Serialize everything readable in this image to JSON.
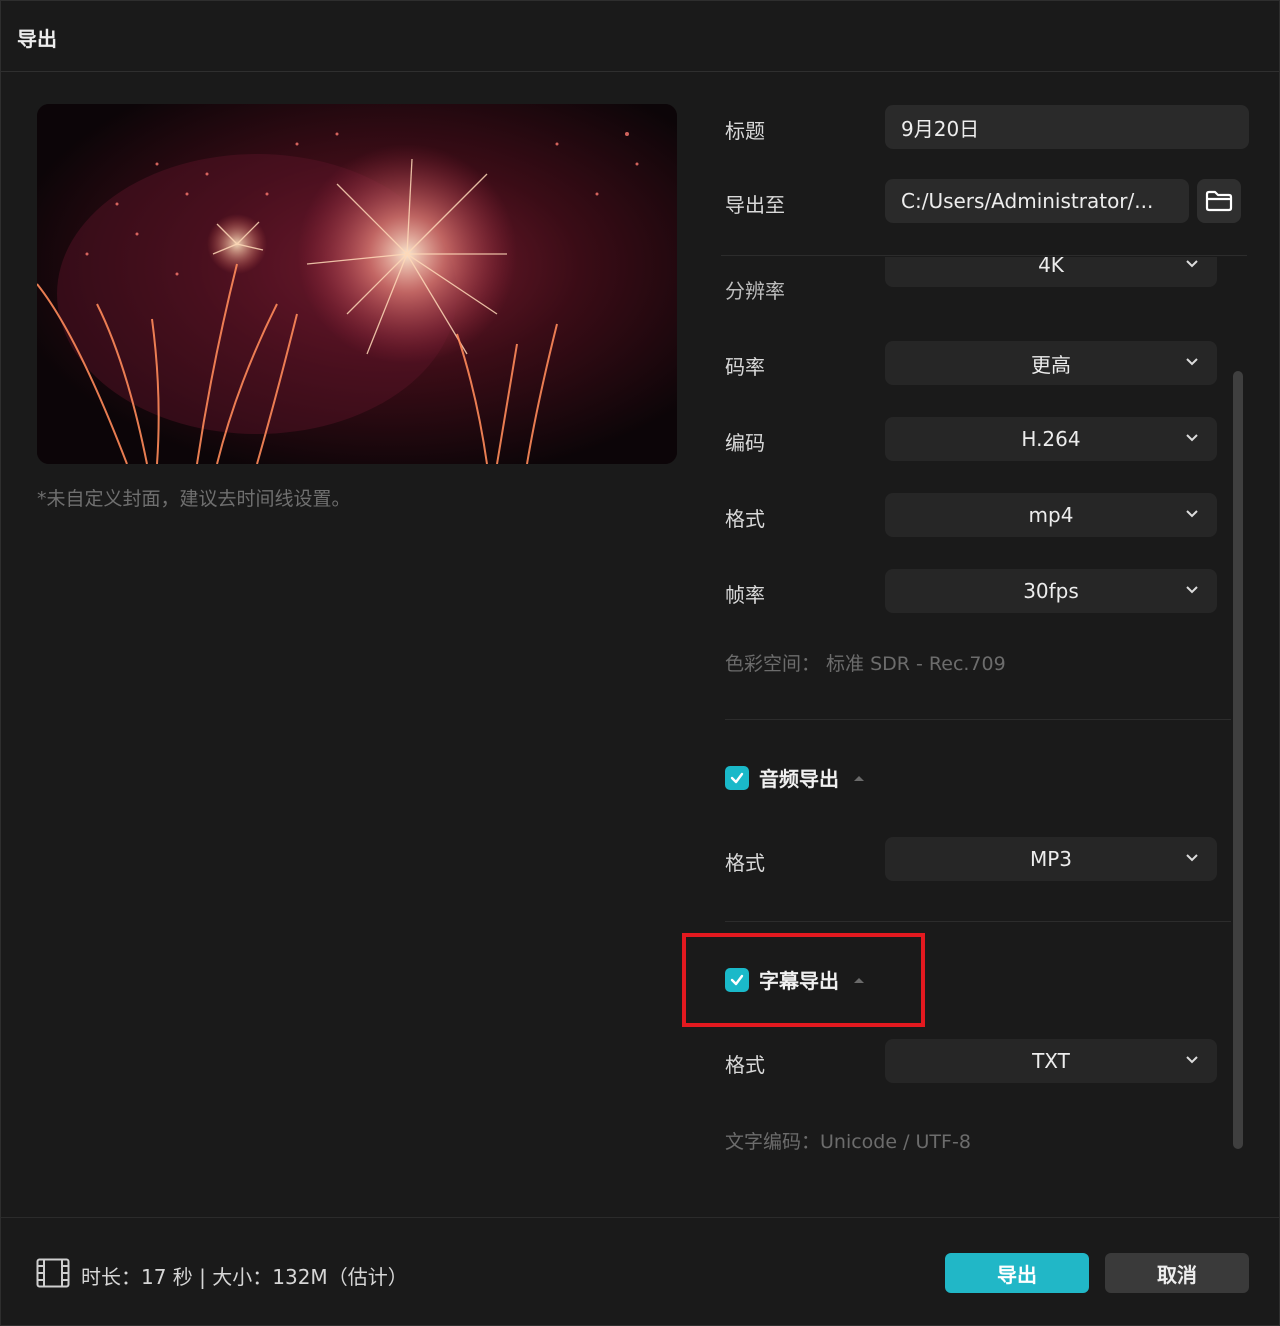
{
  "dialog": {
    "title": "导出"
  },
  "preview": {
    "hint": "*未自定义封面，建议去时间线设置。"
  },
  "fields": {
    "title_label": "标题",
    "title_value": "9月20日",
    "export_to_label": "导出至",
    "export_to_value": "C:/Users/Administrator/...",
    "folder_icon": "folder-icon"
  },
  "video": {
    "resolution": {
      "label": "分辨率",
      "value": "4K"
    },
    "bitrate": {
      "label": "码率",
      "value": "更高"
    },
    "codec": {
      "label": "编码",
      "value": "H.264"
    },
    "format": {
      "label": "格式",
      "value": "mp4"
    },
    "framerate": {
      "label": "帧率",
      "value": "30fps"
    },
    "color_space": "色彩空间：  标准 SDR - Rec.709"
  },
  "audio": {
    "section_label": "音频导出",
    "checked": true,
    "format_label": "格式",
    "format_value": "MP3"
  },
  "subtitle": {
    "section_label": "字幕导出",
    "checked": true,
    "format_label": "格式",
    "format_value": "TXT",
    "encoding": "文字编码：Unicode / UTF-8"
  },
  "footer": {
    "info": "时长：17 秒 | 大小：132M（估计）",
    "export_button": "导出",
    "cancel_button": "取消"
  },
  "colors": {
    "accent": "#21b7c7",
    "highlight": "#e3191f",
    "background": "#1a1a1a"
  }
}
